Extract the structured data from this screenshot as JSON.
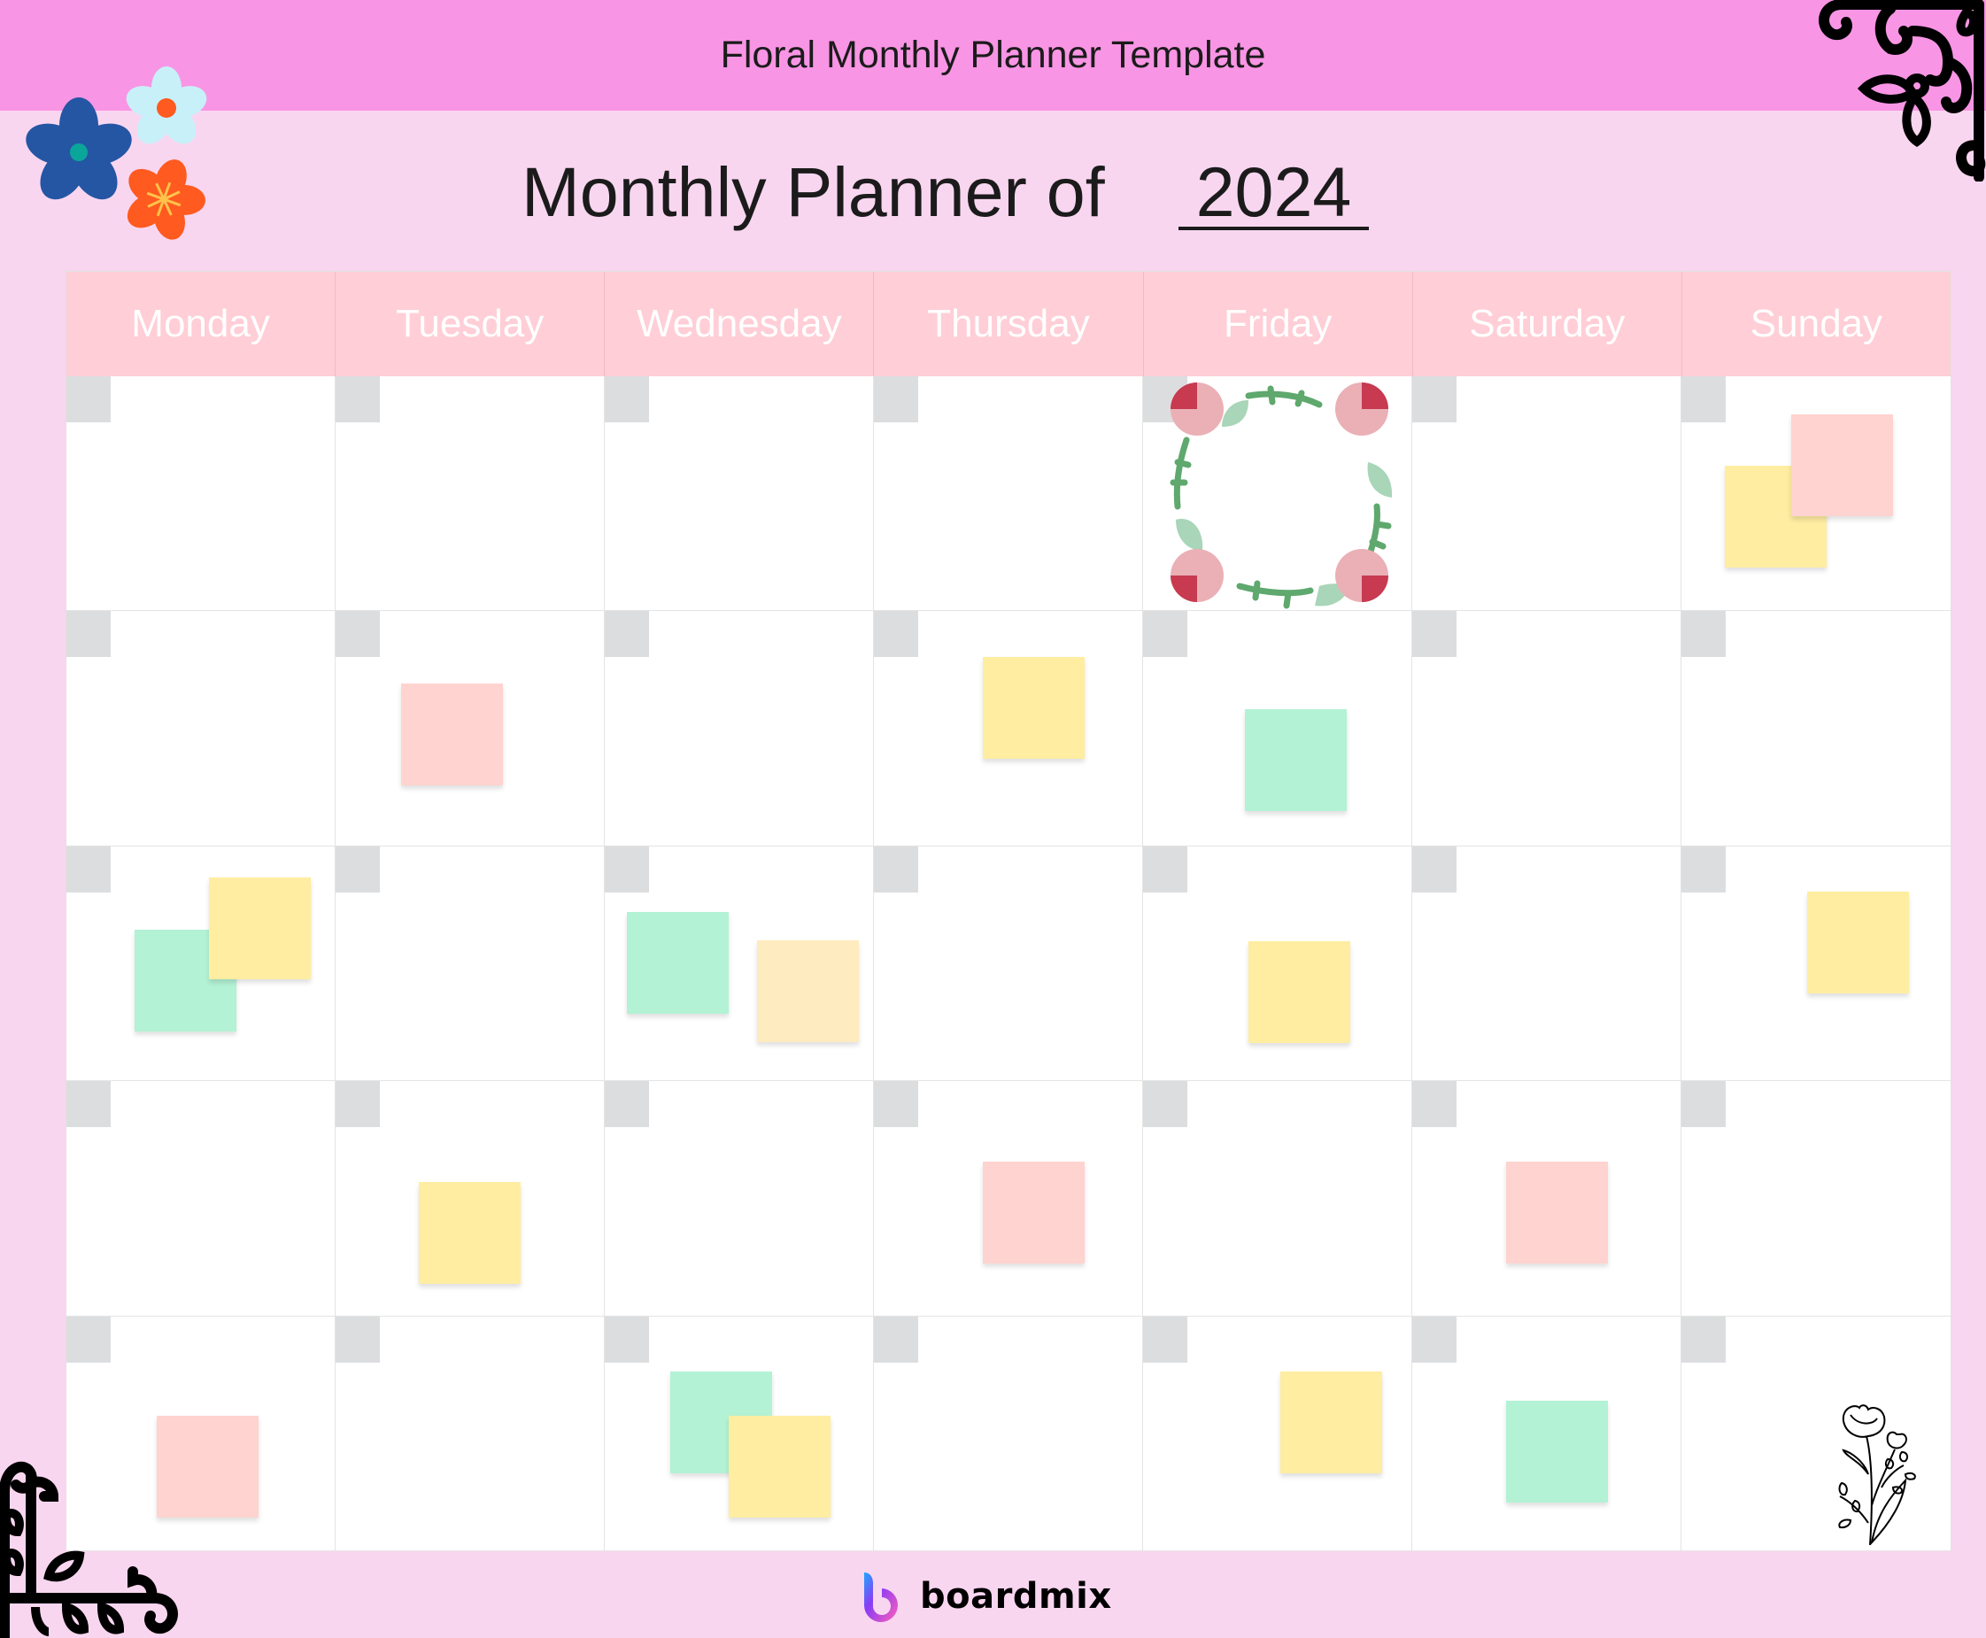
{
  "header": {
    "title": "Floral Monthly Planner Template"
  },
  "planner": {
    "title": "Monthly Planner of",
    "year": "2024"
  },
  "calendar": {
    "days": [
      "Monday",
      "Tuesday",
      "Wednesday",
      "Thursday",
      "Friday",
      "Saturday",
      "Sunday"
    ],
    "weeks": 5,
    "cell_dates": [
      "",
      "",
      "",
      "",
      "",
      "",
      "",
      "",
      "",
      "",
      "",
      "",
      "",
      "",
      "",
      "",
      "",
      "",
      "",
      "",
      "",
      "",
      "",
      "",
      "",
      "",
      "",
      "",
      "",
      "",
      "",
      "",
      "",
      "",
      ""
    ]
  },
  "sticky_colors": {
    "yellow": "#FFEDA1",
    "pink": "#FFD3CF",
    "green": "#B3F2D5",
    "orange": "#FFEBC0"
  },
  "sticky_notes": [
    {
      "week": 1,
      "day": "Sunday",
      "color": "yellow",
      "text": ""
    },
    {
      "week": 1,
      "day": "Sunday",
      "color": "pink",
      "text": ""
    },
    {
      "week": 2,
      "day": "Tuesday",
      "color": "pink",
      "text": ""
    },
    {
      "week": 2,
      "day": "Thursday",
      "color": "yellow",
      "text": ""
    },
    {
      "week": 2,
      "day": "Friday",
      "color": "green",
      "text": ""
    },
    {
      "week": 3,
      "day": "Monday",
      "color": "green",
      "text": ""
    },
    {
      "week": 3,
      "day": "Monday",
      "color": "yellow",
      "text": ""
    },
    {
      "week": 3,
      "day": "Wednesday",
      "color": "green",
      "text": ""
    },
    {
      "week": 3,
      "day": "Wednesday",
      "color": "orange",
      "text": ""
    },
    {
      "week": 3,
      "day": "Friday",
      "color": "yellow",
      "text": ""
    },
    {
      "week": 3,
      "day": "Sunday",
      "color": "yellow",
      "text": ""
    },
    {
      "week": 4,
      "day": "Tuesday",
      "color": "yellow",
      "text": ""
    },
    {
      "week": 4,
      "day": "Thursday",
      "color": "pink",
      "text": ""
    },
    {
      "week": 4,
      "day": "Saturday",
      "color": "pink",
      "text": ""
    },
    {
      "week": 5,
      "day": "Monday",
      "color": "pink",
      "text": ""
    },
    {
      "week": 5,
      "day": "Wednesday",
      "color": "green",
      "text": ""
    },
    {
      "week": 5,
      "day": "Wednesday",
      "color": "yellow",
      "text": ""
    },
    {
      "week": 5,
      "day": "Friday",
      "color": "yellow",
      "text": ""
    },
    {
      "week": 5,
      "day": "Saturday",
      "color": "green",
      "text": ""
    }
  ],
  "decorations": {
    "top_left": "flowers-cluster-icon",
    "top_right": "corner-ornament-icon",
    "bottom_left": "corner-ornament-icon",
    "week1_friday": "rose-wreath-icon",
    "bottom_right_cell": "flower-sketch-icon"
  },
  "brand": {
    "name": "boardmix"
  },
  "colors": {
    "topbar": "#F995E5",
    "page": "#F9D6F0",
    "day_header": "#FFCED6",
    "date_box": "#DCDDDF"
  }
}
